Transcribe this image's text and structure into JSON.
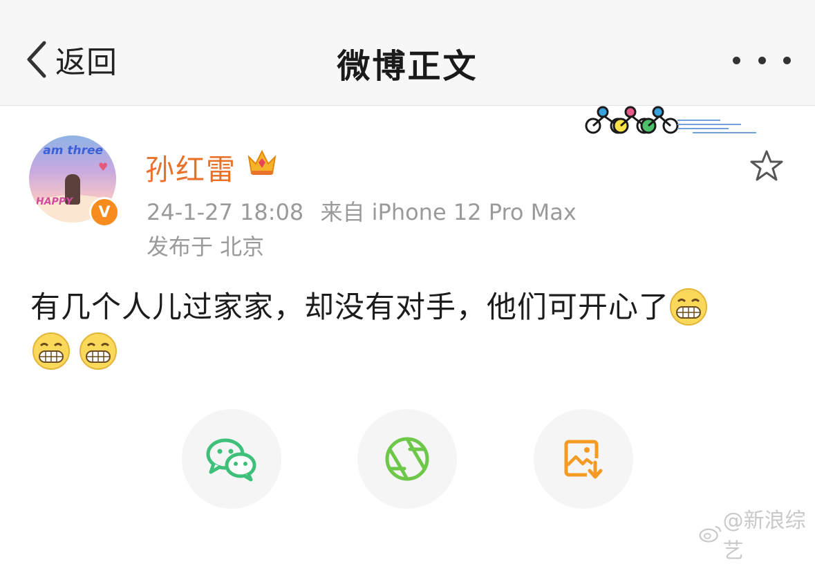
{
  "header": {
    "back_label": "返回",
    "title": "微博正文"
  },
  "post": {
    "author": "孙红雷",
    "avatar": {
      "text": "I am three",
      "caption": "HAPPY"
    },
    "verified_badge": "V",
    "date": "24-1-27 18:08",
    "source": "来自 iPhone 12 Pro Max",
    "location": "发布于 北京",
    "text": "有几个人儿过家家，却没有对手，他们可开心了",
    "emoji_name": "grin-emoji",
    "emoji_count": 3
  },
  "share": {
    "items": [
      "wechat-icon",
      "moments-icon",
      "save-image-icon"
    ]
  },
  "watermark": {
    "text": "@新浪综艺"
  },
  "colors": {
    "accent": "#e8722a",
    "badge": "#f78b1e",
    "wechat": "#3ec07a",
    "moments": "#6dc84a",
    "save": "#f59a23"
  }
}
